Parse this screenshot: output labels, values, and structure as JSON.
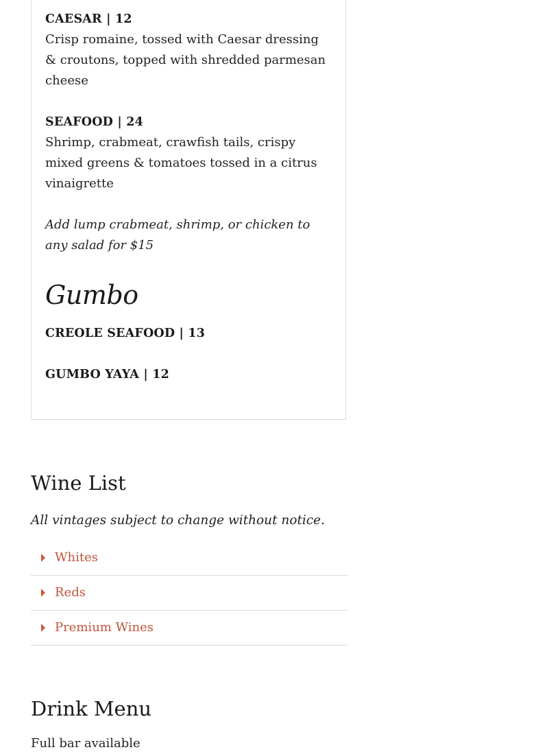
{
  "salads": [
    {
      "title": "CAESAR | 12",
      "desc": "Crisp romaine, tossed with Caesar dressing & croutons, topped with shredded parmesan cheese"
    },
    {
      "title": "SEAFOOD | 24",
      "desc": "Shrimp, crabmeat, crawfish tails, crispy mixed greens & tomatoes tossed in a citrus vinaigrette"
    }
  ],
  "salad_note": "Add lump crabmeat, shrimp, or chicken to any salad for $15",
  "gumbo": {
    "heading": "Gumbo",
    "items": [
      {
        "title": "CREOLE SEAFOOD | 13"
      },
      {
        "title": "GUMBO YAYA | 12"
      }
    ]
  },
  "wine_list": {
    "heading": "Wine List",
    "subtitle": "All vintages subject to change without notice.",
    "sections": [
      "Whites",
      "Reds",
      "Premium Wines"
    ],
    "accent_color": "#c0543a"
  },
  "drink_menu": {
    "heading": "Drink Menu",
    "first_line": "Full bar available"
  }
}
